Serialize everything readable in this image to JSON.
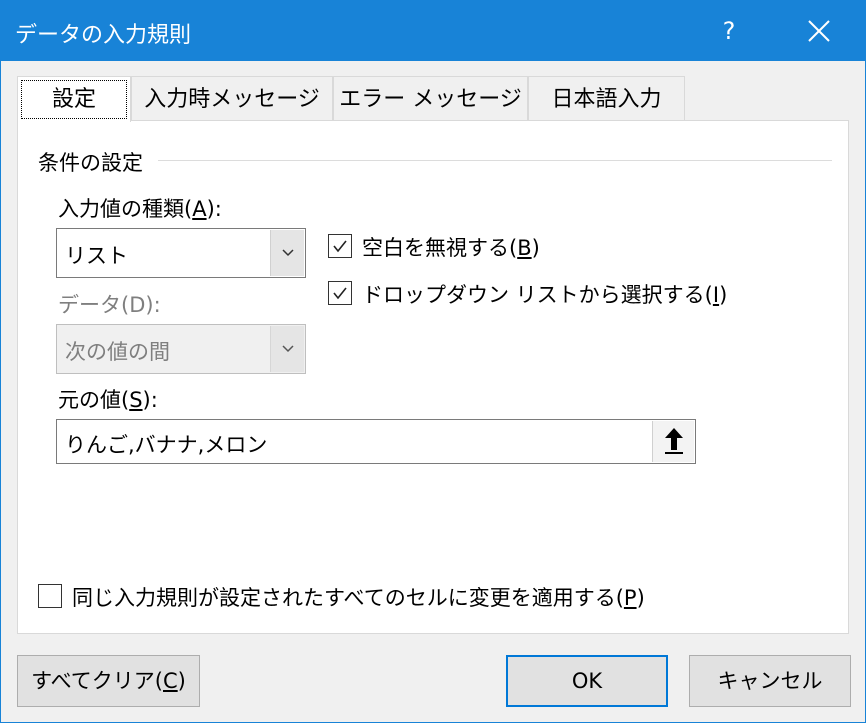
{
  "window": {
    "title": "データの入力規則",
    "help_label": "?",
    "accent": "#1883d7"
  },
  "tabs": [
    {
      "label": "設定",
      "active": true
    },
    {
      "label": "入力時メッセージ",
      "active": false
    },
    {
      "label": "エラー メッセージ",
      "active": false
    },
    {
      "label": "日本語入力",
      "active": false
    }
  ],
  "conditions": {
    "group_label": "条件の設定",
    "allow": {
      "label_before": "入力値の種類(",
      "hotkey": "A",
      "label_after": "):",
      "value": "リスト"
    },
    "data": {
      "label_before": "データ(",
      "hotkey": "D",
      "label_after": "):",
      "value": "次の値の間",
      "disabled": true
    },
    "ignore_blank": {
      "label_before": "空白を無視する(",
      "hotkey": "B",
      "label_after": ")",
      "checked": true
    },
    "in_cell_dropdown": {
      "label_before": "ドロップダウン リストから選択する(",
      "hotkey": "I",
      "label_after": ")",
      "checked": true
    },
    "source": {
      "label_before": "元の値(",
      "hotkey": "S",
      "label_after": "):",
      "value": "りんご,バナナ,メロン"
    },
    "apply_all": {
      "label_before": "同じ入力規則が設定されたすべてのセルに変更を適用する(",
      "hotkey": "P",
      "label_after": ")",
      "checked": false
    }
  },
  "buttons": {
    "clear_all_before": "すべてクリア(",
    "clear_all_hotkey": "C",
    "clear_all_after": ")",
    "ok": "OK",
    "cancel": "キャンセル"
  }
}
